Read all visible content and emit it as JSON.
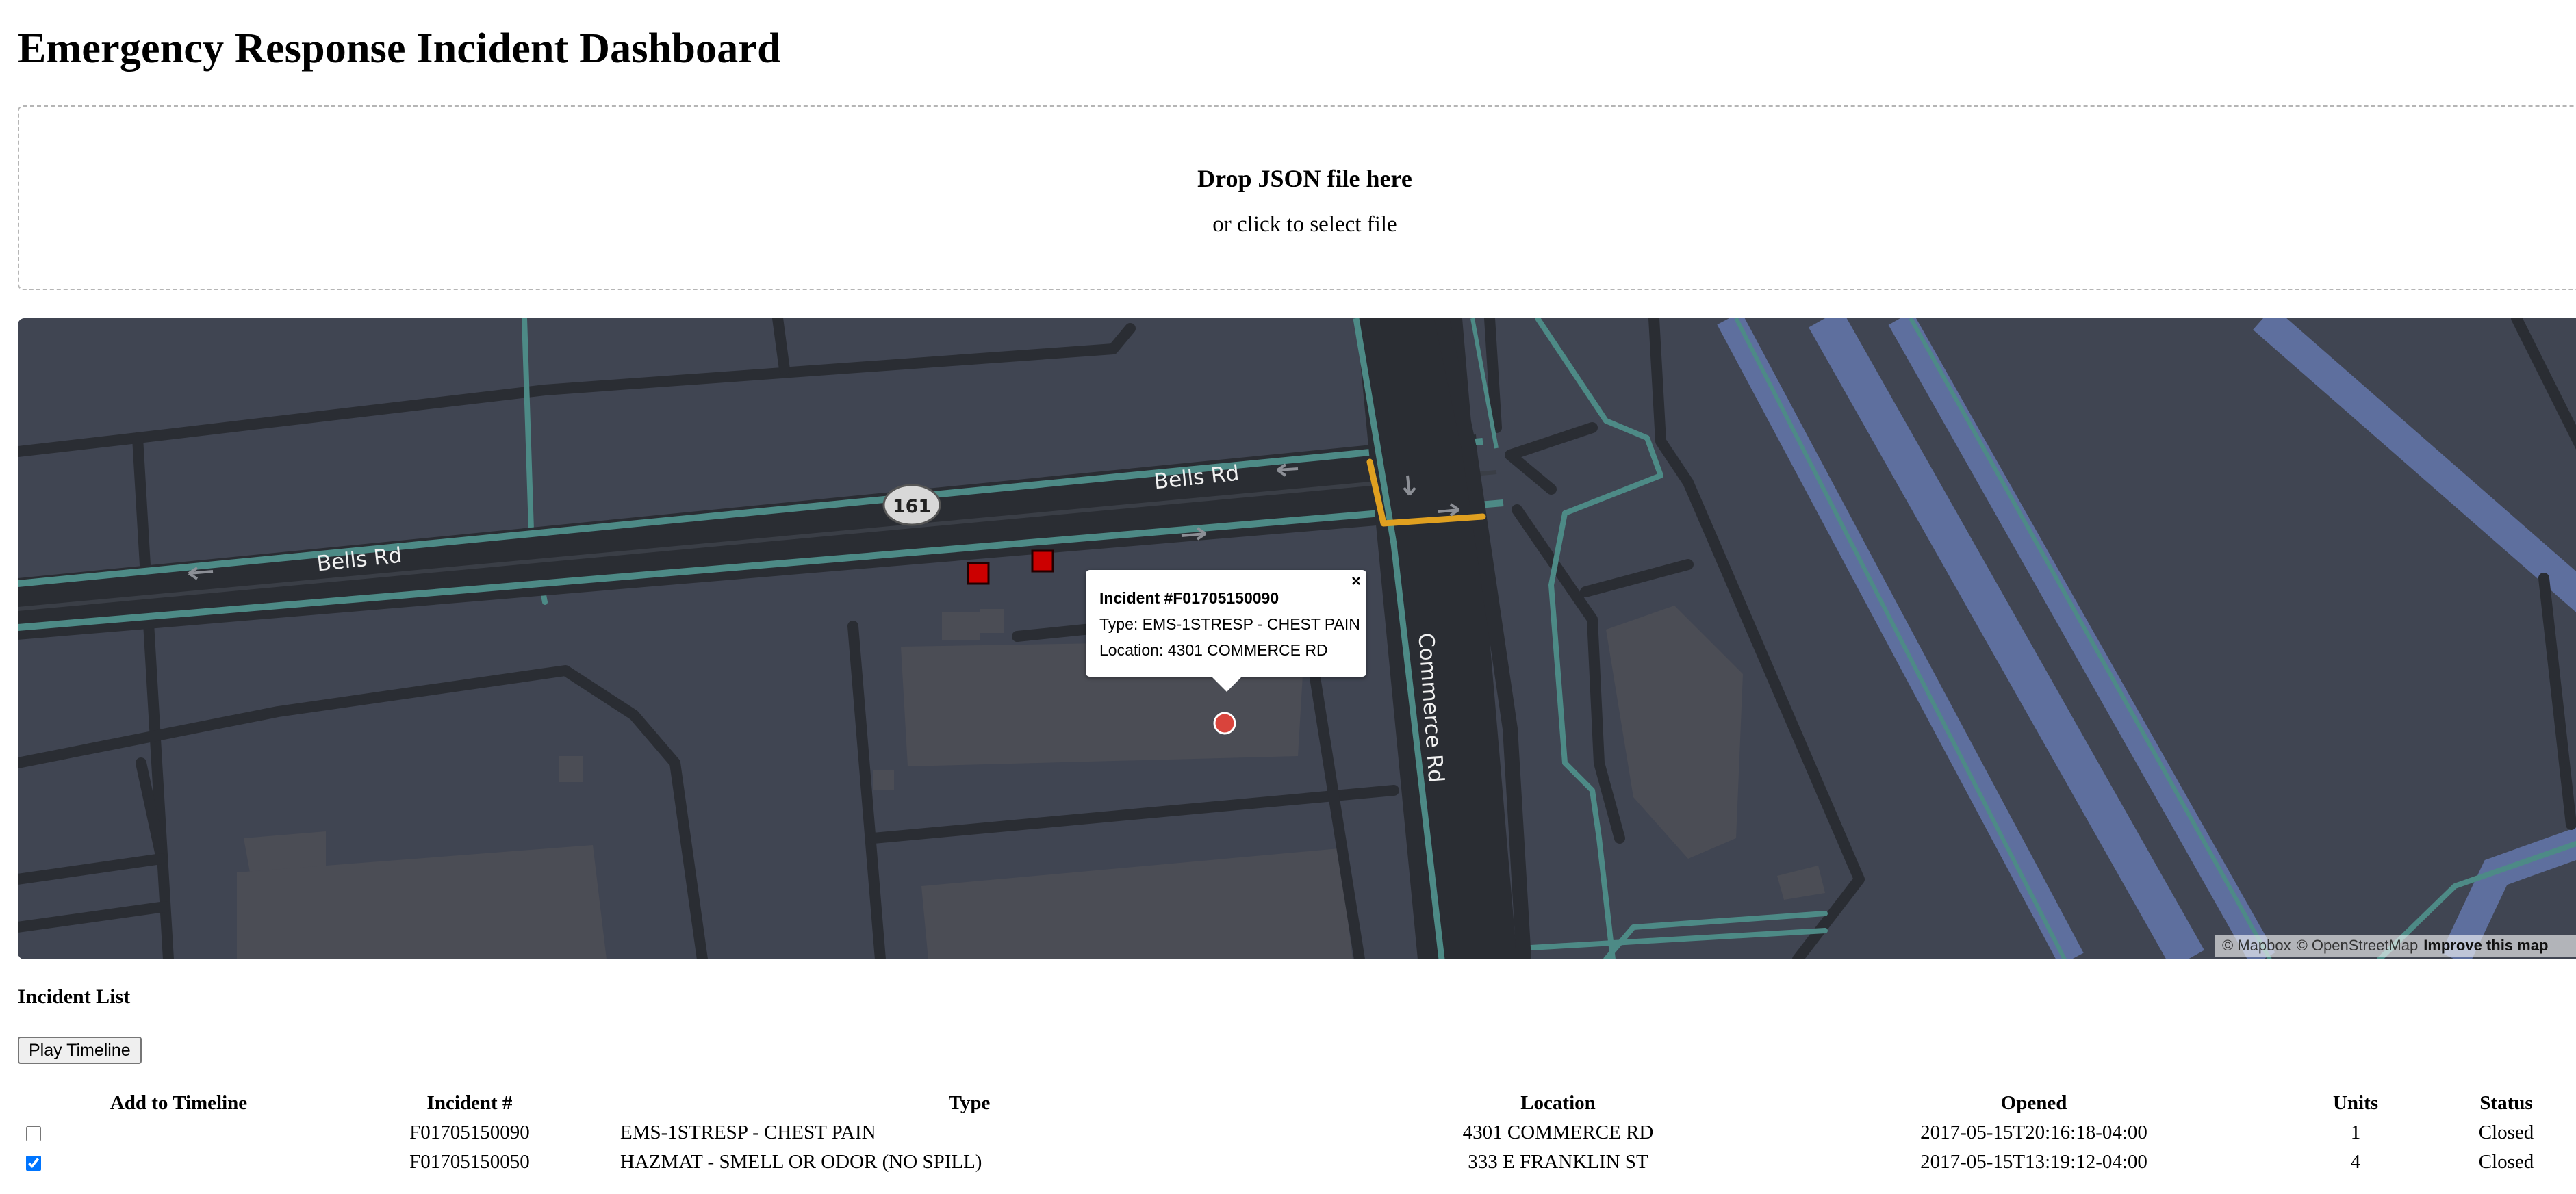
{
  "page": {
    "title": "Emergency Response Incident Dashboard"
  },
  "dropzone": {
    "title": "Drop JSON file here",
    "subtitle": "or click to select file"
  },
  "map": {
    "labels": {
      "bells_rd_west": "Bells Rd",
      "bells_rd_east": "Bells Rd",
      "commerce_rd": "Commerce Rd",
      "route_shield": "161"
    },
    "attribution": {
      "mapbox": "© Mapbox",
      "osm": "© OpenStreetMap",
      "improve": "Improve this map"
    },
    "colors": {
      "background": "#404552",
      "road": "#2a2d33",
      "road_outline": "#4d8a86",
      "water": "#5e6f9e",
      "building": "#4b4d55",
      "highlight_road": "#e0a020",
      "incident_marker": "#d9443c",
      "unit_marker": "#cc0000"
    },
    "popup": {
      "title": "Incident #F01705150090",
      "type_line": "Type: EMS-1STRESP - CHEST PAIN",
      "location_line": "Location: 4301 COMMERCE RD",
      "close": "×"
    }
  },
  "incident_list": {
    "title": "Incident List",
    "play_button": "Play Timeline",
    "columns": [
      "Add to Timeline",
      "Incident #",
      "Type",
      "Location",
      "Opened",
      "Units",
      "Status"
    ],
    "rows": [
      {
        "checked": false,
        "incident": "F01705150090",
        "type": "EMS-1STRESP - CHEST PAIN",
        "location": "4301 COMMERCE RD",
        "opened": "2017-05-15T20:16:18-04:00",
        "units": "1",
        "status": "Closed"
      },
      {
        "checked": true,
        "incident": "F01705150050",
        "type": "HAZMAT - SMELL OR ODOR (NO SPILL)",
        "location": "333 E FRANKLIN ST",
        "opened": "2017-05-15T13:19:12-04:00",
        "units": "4",
        "status": "Closed"
      }
    ]
  }
}
